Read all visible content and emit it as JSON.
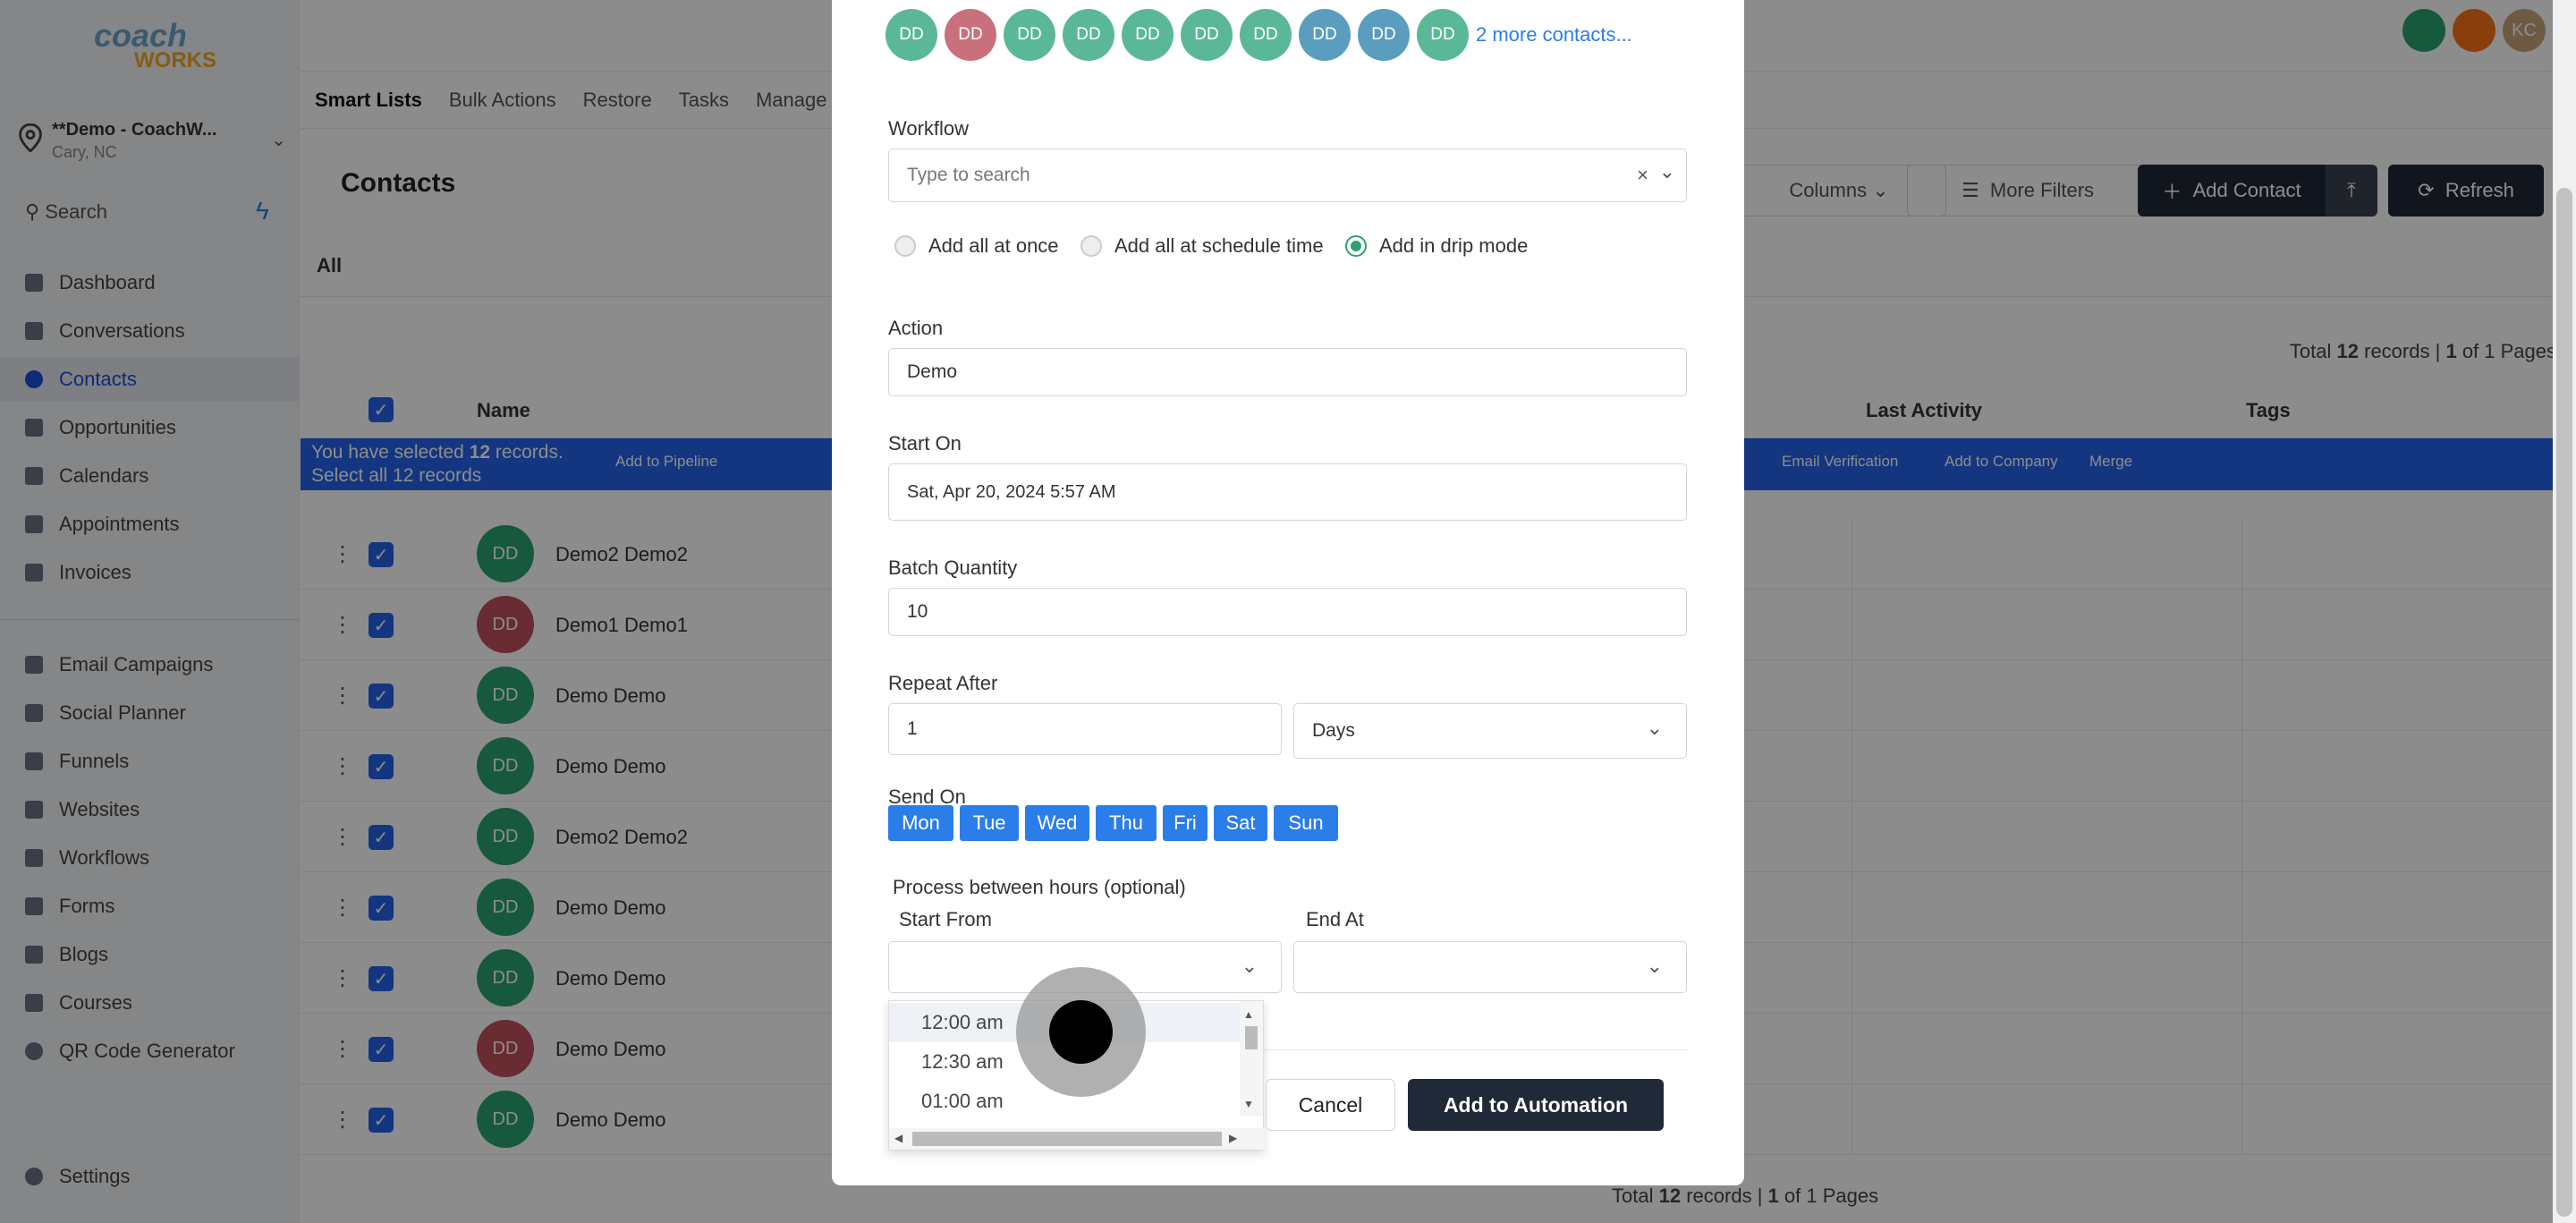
{
  "sidebar": {
    "logo_top": "coach",
    "logo_bottom": "WORKS",
    "location_name": "**Demo - CoachW...",
    "location_city": "Cary, NC",
    "search_label": "Search",
    "items": [
      {
        "label": "Dashboard"
      },
      {
        "label": "Conversations"
      },
      {
        "label": "Contacts"
      },
      {
        "label": "Opportunities"
      },
      {
        "label": "Calendars"
      },
      {
        "label": "Appointments"
      },
      {
        "label": "Invoices"
      },
      {
        "label": "Email Campaigns"
      },
      {
        "label": "Social Planner"
      },
      {
        "label": "Funnels"
      },
      {
        "label": "Websites"
      },
      {
        "label": "Workflows"
      },
      {
        "label": "Forms"
      },
      {
        "label": "Blogs"
      },
      {
        "label": "Courses"
      },
      {
        "label": "QR Code Generator"
      }
    ],
    "settings_label": "Settings"
  },
  "header": {
    "tabs": [
      "Smart Lists",
      "Bulk Actions",
      "Restore",
      "Tasks",
      "Manage"
    ],
    "user_initials": "KC"
  },
  "contacts": {
    "title": "Contacts",
    "columns_btn": "Columns",
    "more_filters_btn": "More Filters",
    "add_contact_btn": "Add Contact",
    "refresh_btn": "Refresh",
    "all_tab": "All",
    "total_prefix": "Total",
    "total_count": "12",
    "total_mid": "records |",
    "page_current": "1",
    "page_suffix": "of 1 Pages",
    "col_name": "Name",
    "col_last_activity": "Last Activity",
    "col_tags": "Tags",
    "selection_prefix": "You have selected",
    "selection_count": "12",
    "selection_suffix": "records.",
    "select_all": "Select all 12 records",
    "bulk_actions": [
      "Add to Pipeline",
      "Email Verification",
      "Add to Company",
      "Merge"
    ],
    "rows": [
      {
        "initials": "DD",
        "name": "Demo2 Demo2",
        "color": "#2ba36f"
      },
      {
        "initials": "DD",
        "name": "Demo1 Demo1",
        "color": "#c0505e"
      },
      {
        "initials": "DD",
        "name": "Demo Demo",
        "color": "#2ba36f"
      },
      {
        "initials": "DD",
        "name": "Demo Demo",
        "color": "#2ba36f"
      },
      {
        "initials": "DD",
        "name": "Demo2 Demo2",
        "color": "#2ba36f"
      },
      {
        "initials": "DD",
        "name": "Demo Demo",
        "color": "#2ba36f"
      },
      {
        "initials": "DD",
        "name": "Demo Demo",
        "color": "#2ba36f"
      },
      {
        "initials": "DD",
        "name": "Demo Demo",
        "color": "#c0505e"
      },
      {
        "initials": "DD",
        "name": "Demo Demo",
        "color": "#2ba36f"
      }
    ],
    "bottom_total_prefix": "Total",
    "bottom_total_count": "12",
    "bottom_total_mid": "records |",
    "bottom_page_current": "1",
    "bottom_page_suffix": "of 1 Pages"
  },
  "modal": {
    "avatars": [
      {
        "initials": "DD",
        "color": "#5bb897"
      },
      {
        "initials": "DD",
        "color": "#c9707c"
      },
      {
        "initials": "DD",
        "color": "#5bb897"
      },
      {
        "initials": "DD",
        "color": "#5bb897"
      },
      {
        "initials": "DD",
        "color": "#5bb897"
      },
      {
        "initials": "DD",
        "color": "#5bb897"
      },
      {
        "initials": "DD",
        "color": "#5bb897"
      },
      {
        "initials": "DD",
        "color": "#5a9dbf"
      },
      {
        "initials": "DD",
        "color": "#5a9dbf"
      },
      {
        "initials": "DD",
        "color": "#5bb897"
      }
    ],
    "more_contacts": "2 more contacts...",
    "workflow_label": "Workflow",
    "workflow_placeholder": "Type to search",
    "radio_options": [
      {
        "label": "Add all at once",
        "selected": false
      },
      {
        "label": "Add all at schedule time",
        "selected": false
      },
      {
        "label": "Add in drip mode",
        "selected": true
      }
    ],
    "action_label": "Action",
    "action_value": "Demo",
    "start_on_label": "Start On",
    "start_on_value": "Sat, Apr 20, 2024 5:57 AM",
    "batch_label": "Batch Quantity",
    "batch_value": "10",
    "repeat_label": "Repeat After",
    "repeat_value": "1",
    "repeat_unit": "Days",
    "send_on_label": "Send On",
    "days": [
      "Mon",
      "Tue",
      "Wed",
      "Thu",
      "Fri",
      "Sat",
      "Sun"
    ],
    "process_label": "Process between hours (optional)",
    "start_from_label": "Start From",
    "end_at_label": "End At",
    "time_options": [
      "12:00 am",
      "12:30 am",
      "01:00 am"
    ],
    "cancel_btn": "Cancel",
    "add_btn": "Add to Automation"
  },
  "colors": {
    "primary": "#2b7de9",
    "selection_bar": "#2563eb",
    "dark_button": "#1f2937",
    "green_avatar": "#2ba36f",
    "red_avatar": "#c0505e"
  }
}
